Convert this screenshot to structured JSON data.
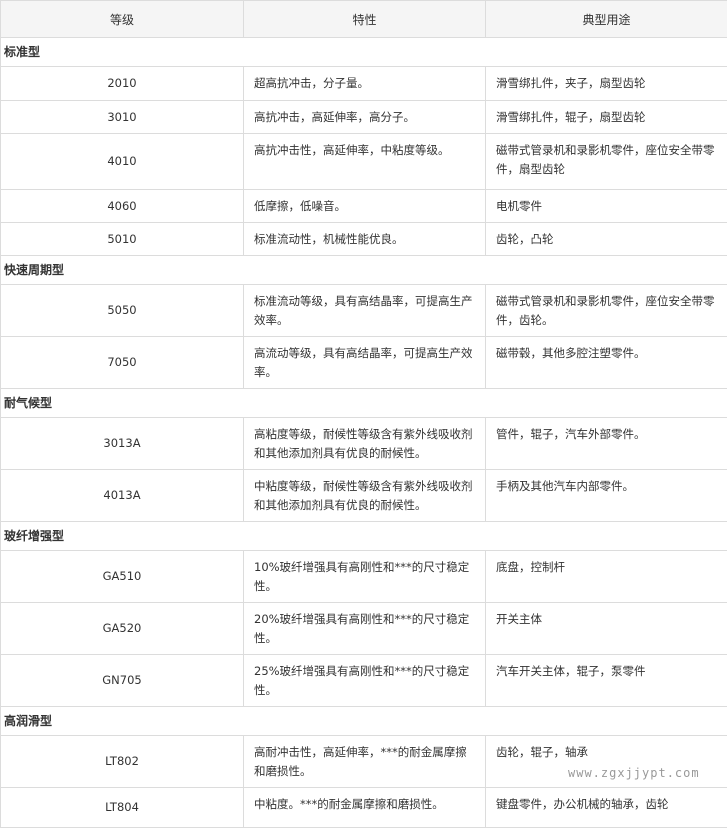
{
  "headers": {
    "grade": "等级",
    "property": "特性",
    "application": "典型用途"
  },
  "sections": [
    {
      "title": "标准型",
      "rows": [
        {
          "grade": "2010",
          "property": "超高抗冲击，分子量。",
          "application": "滑雪绑扎件，夹子，扇型齿轮"
        },
        {
          "grade": "3010",
          "property": "高抗冲击，高延伸率，高分子。",
          "application": "滑雪绑扎件，辊子，扇型齿轮"
        },
        {
          "grade": "4010",
          "property": "高抗冲击性，高延伸率，中粘度等级。",
          "application": "磁带式管录机和录影机零件，座位安全带零件，扇型齿轮"
        },
        {
          "grade": "4060",
          "property": "低摩擦，低噪音。",
          "application": "电机零件"
        },
        {
          "grade": "5010",
          "property": "标准流动性，机械性能优良。",
          "application": "齿轮，凸轮"
        }
      ]
    },
    {
      "title": "快速周期型",
      "rows": [
        {
          "grade": "5050",
          "property": "标准流动等级，具有高结晶率，可提高生产效率。",
          "application": "磁带式管录机和录影机零件，座位安全带零件，齿轮。"
        },
        {
          "grade": "7050",
          "property": "高流动等级，具有高结晶率，可提高生产效率。",
          "application": "磁带毂，其他多腔注塑零件。"
        }
      ]
    },
    {
      "title": "耐气候型",
      "rows": [
        {
          "grade": "3013A",
          "property": "高粘度等级，耐候性等级含有紫外线吸收剂和其他添加剂具有优良的耐候性。",
          "application": "管件，辊子，汽车外部零件。"
        },
        {
          "grade": "4013A",
          "property": "中粘度等级，耐候性等级含有紫外线吸收剂和其他添加剂具有优良的耐候性。",
          "application": "手柄及其他汽车内部零件。"
        }
      ]
    },
    {
      "title": "玻纤增强型",
      "rows": [
        {
          "grade": "GA510",
          "property": "10%玻纤增强具有高刚性和***的尺寸稳定性。",
          "application": "底盘，控制杆"
        },
        {
          "grade": "GA520",
          "property": "20%玻纤增强具有高刚性和***的尺寸稳定性。",
          "application": "开关主体"
        },
        {
          "grade": "GN705",
          "property": "25%玻纤增强具有高刚性和***的尺寸稳定性。",
          "application": "汽车开关主体，辊子，泵零件"
        }
      ]
    },
    {
      "title": "高润滑型",
      "rows": [
        {
          "grade": "LT802",
          "property": "高耐冲击性，高延伸率，***的耐金属摩擦和磨损性。",
          "application": "齿轮，辊子，轴承"
        },
        {
          "grade": "LT804",
          "property": "中粘度。***的耐金属摩擦和磨损性。",
          "application": "键盘零件，办公机械的轴承，齿轮"
        }
      ]
    }
  ],
  "watermark": "www.zgxjjypt.com"
}
